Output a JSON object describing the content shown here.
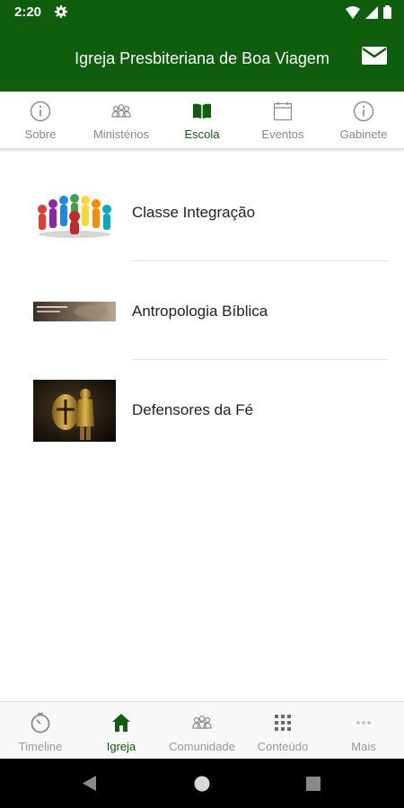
{
  "status_bar": {
    "time": "2:20"
  },
  "app_bar": {
    "title": "Igreja Presbiteriana de Boa Viagem"
  },
  "top_tabs": [
    {
      "label": "Sobre",
      "icon": "info-icon",
      "active": false
    },
    {
      "label": "Ministérios",
      "icon": "people-icon",
      "active": false
    },
    {
      "label": "Escola",
      "icon": "book-icon",
      "active": true
    },
    {
      "label": "Eventos",
      "icon": "calendar-icon",
      "active": false
    },
    {
      "label": "Gabinete",
      "icon": "info-icon",
      "active": false
    }
  ],
  "list_items": [
    {
      "title": "Classe Integração",
      "thumb": "colorful-people-circle"
    },
    {
      "title": "Antropologia Bíblica",
      "thumb": "banner-image"
    },
    {
      "title": "Defensores da Fé",
      "thumb": "armored-knight"
    }
  ],
  "bottom_nav": [
    {
      "label": "Timeline",
      "icon": "clock-icon",
      "active": false
    },
    {
      "label": "Igreja",
      "icon": "home-icon",
      "active": true
    },
    {
      "label": "Comunidade",
      "icon": "people-icon",
      "active": false
    },
    {
      "label": "Conteúdo",
      "icon": "grid-icon",
      "active": false
    },
    {
      "label": "Mais",
      "icon": "more-icon",
      "active": false
    }
  ],
  "colors": {
    "primary": "#0e5e0e",
    "inactive": "#8a8a8a"
  }
}
